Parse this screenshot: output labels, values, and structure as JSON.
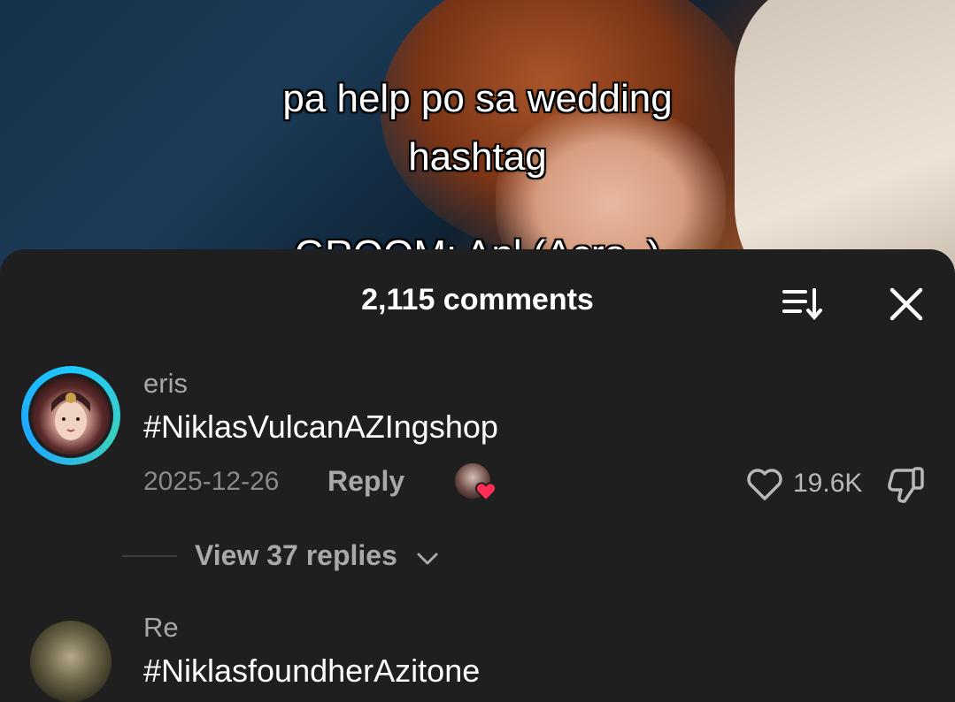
{
  "video": {
    "caption_line1": "pa help po sa wedding",
    "caption_line2": "hashtag",
    "caption_line3": "GROOM: Anl (Acro..)"
  },
  "comments_panel": {
    "title": "2,115 comments",
    "sort_icon": "sort-icon",
    "close_icon": "close-icon"
  },
  "comments": [
    {
      "username": "eris",
      "text": "#NiklasVulcanAZIngshop",
      "date": "2025-12-26",
      "reply_label": "Reply",
      "like_count": "19.6K",
      "view_replies": "View 37 replies"
    },
    {
      "username": "Re",
      "text": "#NiklasfoundherAzitone"
    }
  ],
  "colors": {
    "sheet_bg": "#1f1f1f",
    "avatar_ring": "#1ec8ff",
    "heart": "#ff2d55"
  }
}
